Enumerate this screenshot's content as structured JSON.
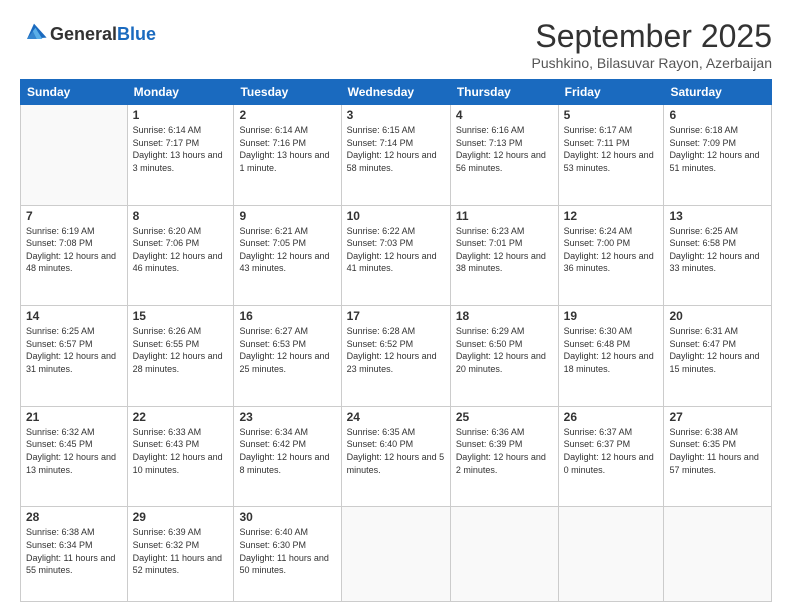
{
  "header": {
    "logo_general": "General",
    "logo_blue": "Blue",
    "month_title": "September 2025",
    "location": "Pushkino, Bilasuvar Rayon, Azerbaijan"
  },
  "days_of_week": [
    "Sunday",
    "Monday",
    "Tuesday",
    "Wednesday",
    "Thursday",
    "Friday",
    "Saturday"
  ],
  "weeks": [
    [
      {
        "day": "",
        "info": ""
      },
      {
        "day": "1",
        "info": "Sunrise: 6:14 AM\nSunset: 7:17 PM\nDaylight: 13 hours\nand 3 minutes."
      },
      {
        "day": "2",
        "info": "Sunrise: 6:14 AM\nSunset: 7:16 PM\nDaylight: 13 hours\nand 1 minute."
      },
      {
        "day": "3",
        "info": "Sunrise: 6:15 AM\nSunset: 7:14 PM\nDaylight: 12 hours\nand 58 minutes."
      },
      {
        "day": "4",
        "info": "Sunrise: 6:16 AM\nSunset: 7:13 PM\nDaylight: 12 hours\nand 56 minutes."
      },
      {
        "day": "5",
        "info": "Sunrise: 6:17 AM\nSunset: 7:11 PM\nDaylight: 12 hours\nand 53 minutes."
      },
      {
        "day": "6",
        "info": "Sunrise: 6:18 AM\nSunset: 7:09 PM\nDaylight: 12 hours\nand 51 minutes."
      }
    ],
    [
      {
        "day": "7",
        "info": "Sunrise: 6:19 AM\nSunset: 7:08 PM\nDaylight: 12 hours\nand 48 minutes."
      },
      {
        "day": "8",
        "info": "Sunrise: 6:20 AM\nSunset: 7:06 PM\nDaylight: 12 hours\nand 46 minutes."
      },
      {
        "day": "9",
        "info": "Sunrise: 6:21 AM\nSunset: 7:05 PM\nDaylight: 12 hours\nand 43 minutes."
      },
      {
        "day": "10",
        "info": "Sunrise: 6:22 AM\nSunset: 7:03 PM\nDaylight: 12 hours\nand 41 minutes."
      },
      {
        "day": "11",
        "info": "Sunrise: 6:23 AM\nSunset: 7:01 PM\nDaylight: 12 hours\nand 38 minutes."
      },
      {
        "day": "12",
        "info": "Sunrise: 6:24 AM\nSunset: 7:00 PM\nDaylight: 12 hours\nand 36 minutes."
      },
      {
        "day": "13",
        "info": "Sunrise: 6:25 AM\nSunset: 6:58 PM\nDaylight: 12 hours\nand 33 minutes."
      }
    ],
    [
      {
        "day": "14",
        "info": "Sunrise: 6:25 AM\nSunset: 6:57 PM\nDaylight: 12 hours\nand 31 minutes."
      },
      {
        "day": "15",
        "info": "Sunrise: 6:26 AM\nSunset: 6:55 PM\nDaylight: 12 hours\nand 28 minutes."
      },
      {
        "day": "16",
        "info": "Sunrise: 6:27 AM\nSunset: 6:53 PM\nDaylight: 12 hours\nand 25 minutes."
      },
      {
        "day": "17",
        "info": "Sunrise: 6:28 AM\nSunset: 6:52 PM\nDaylight: 12 hours\nand 23 minutes."
      },
      {
        "day": "18",
        "info": "Sunrise: 6:29 AM\nSunset: 6:50 PM\nDaylight: 12 hours\nand 20 minutes."
      },
      {
        "day": "19",
        "info": "Sunrise: 6:30 AM\nSunset: 6:48 PM\nDaylight: 12 hours\nand 18 minutes."
      },
      {
        "day": "20",
        "info": "Sunrise: 6:31 AM\nSunset: 6:47 PM\nDaylight: 12 hours\nand 15 minutes."
      }
    ],
    [
      {
        "day": "21",
        "info": "Sunrise: 6:32 AM\nSunset: 6:45 PM\nDaylight: 12 hours\nand 13 minutes."
      },
      {
        "day": "22",
        "info": "Sunrise: 6:33 AM\nSunset: 6:43 PM\nDaylight: 12 hours\nand 10 minutes."
      },
      {
        "day": "23",
        "info": "Sunrise: 6:34 AM\nSunset: 6:42 PM\nDaylight: 12 hours\nand 8 minutes."
      },
      {
        "day": "24",
        "info": "Sunrise: 6:35 AM\nSunset: 6:40 PM\nDaylight: 12 hours\nand 5 minutes."
      },
      {
        "day": "25",
        "info": "Sunrise: 6:36 AM\nSunset: 6:39 PM\nDaylight: 12 hours\nand 2 minutes."
      },
      {
        "day": "26",
        "info": "Sunrise: 6:37 AM\nSunset: 6:37 PM\nDaylight: 12 hours\nand 0 minutes."
      },
      {
        "day": "27",
        "info": "Sunrise: 6:38 AM\nSunset: 6:35 PM\nDaylight: 11 hours\nand 57 minutes."
      }
    ],
    [
      {
        "day": "28",
        "info": "Sunrise: 6:38 AM\nSunset: 6:34 PM\nDaylight: 11 hours\nand 55 minutes."
      },
      {
        "day": "29",
        "info": "Sunrise: 6:39 AM\nSunset: 6:32 PM\nDaylight: 11 hours\nand 52 minutes."
      },
      {
        "day": "30",
        "info": "Sunrise: 6:40 AM\nSunset: 6:30 PM\nDaylight: 11 hours\nand 50 minutes."
      },
      {
        "day": "",
        "info": ""
      },
      {
        "day": "",
        "info": ""
      },
      {
        "day": "",
        "info": ""
      },
      {
        "day": "",
        "info": ""
      }
    ]
  ]
}
